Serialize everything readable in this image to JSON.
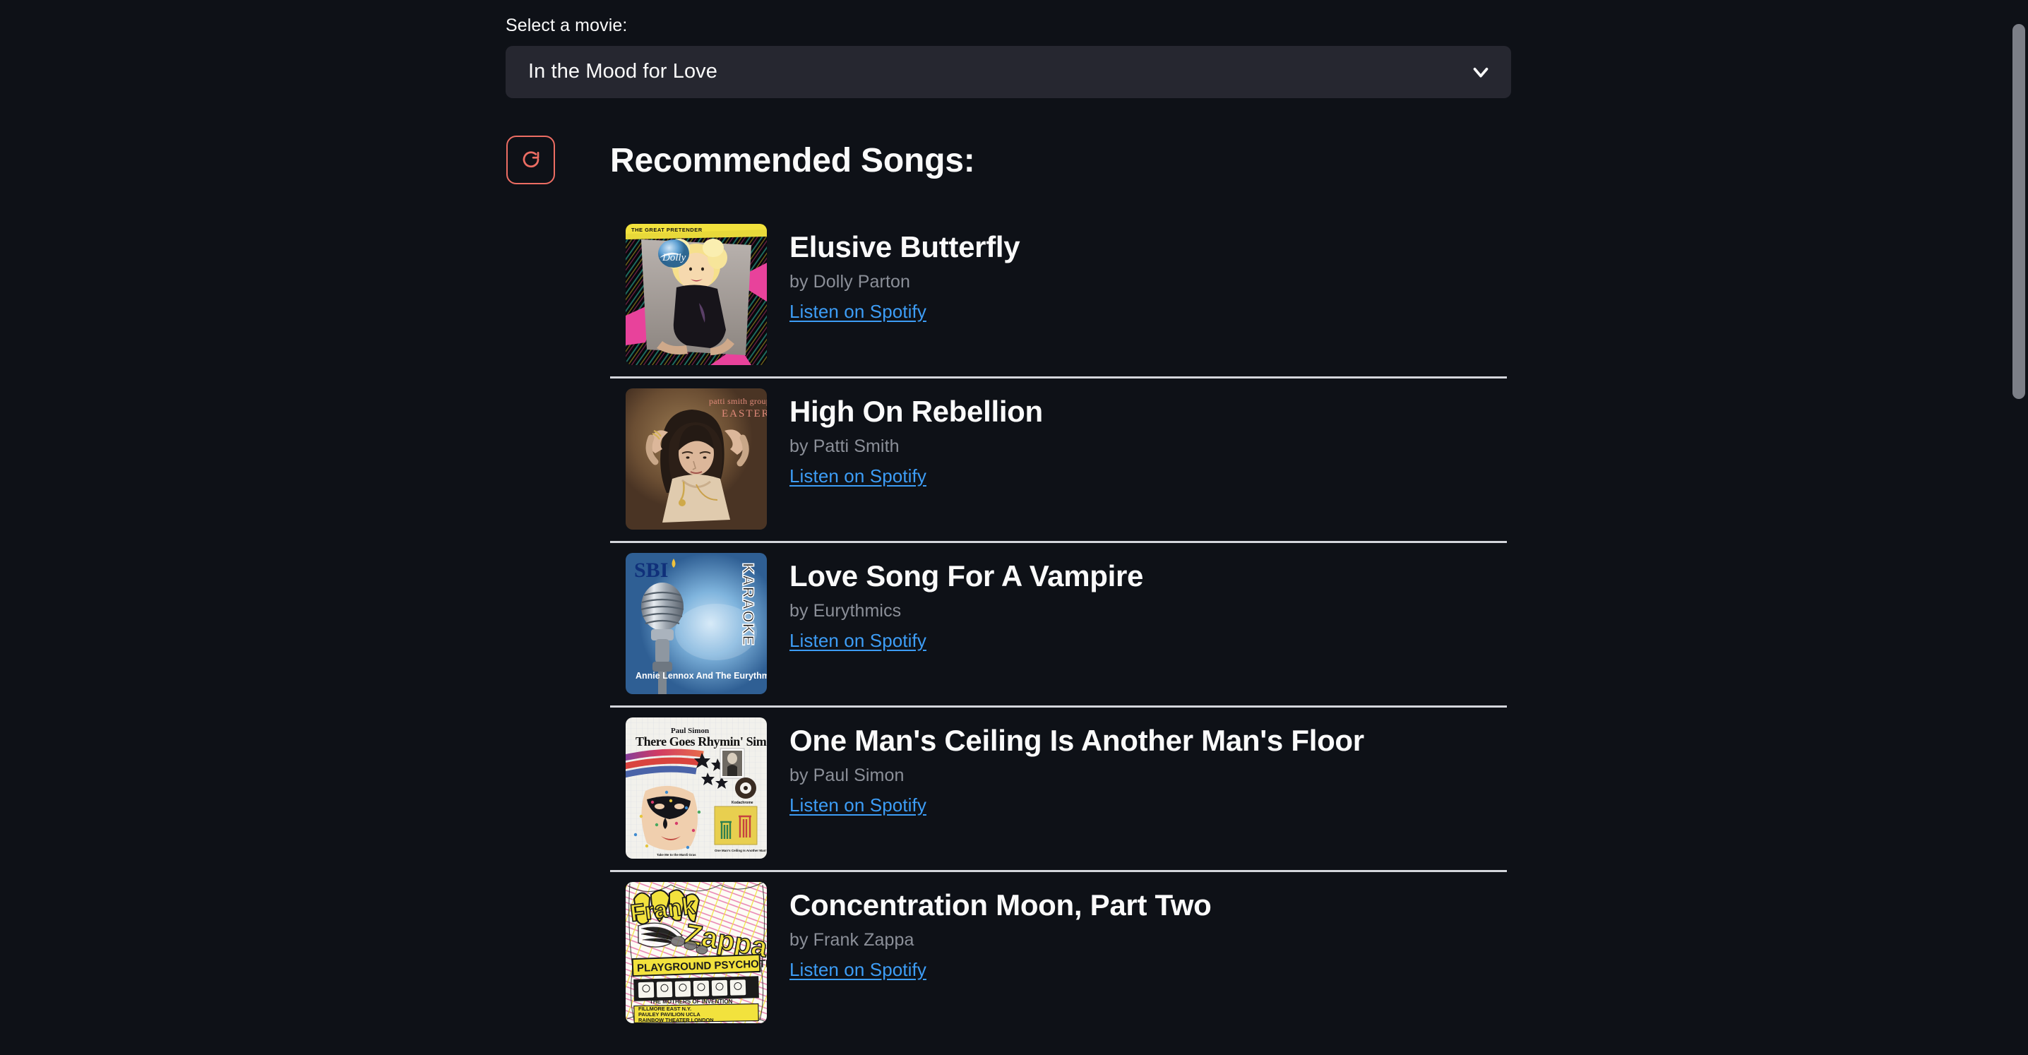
{
  "page": {
    "background_color": "#0e1117",
    "text_color": "#fafafa"
  },
  "select": {
    "label": "Select a movie:",
    "value": "In the Mood for Love",
    "chevron_icon": "chevron-down-icon",
    "background_color": "#262730"
  },
  "refresh": {
    "icon": "refresh-rotate-icon",
    "accent_color": "#ec6d63",
    "label": ""
  },
  "heading": "Recommended Songs:",
  "link_color": "#3d9df6",
  "songs": [
    {
      "title": "Elusive Butterfly",
      "artist": "by Dolly Parton",
      "link_label": "Listen on Spotify",
      "album_art": "dolly-parton-the-great-pretender-cover",
      "album_art_text": "THE GREAT PRETENDER"
    },
    {
      "title": "High On Rebellion",
      "artist": "by Patti Smith",
      "link_label": "Listen on Spotify",
      "album_art": "patti-smith-group-easter-cover",
      "album_art_text": "patti smith group EASTER"
    },
    {
      "title": "Love Song For A Vampire",
      "artist": "by Eurythmics",
      "link_label": "Listen on Spotify",
      "album_art": "sbi-karaoke-annie-lennox-eurythmics-cover",
      "album_art_text": "SBI KARAOKE Annie Lennox And The Eurythmics"
    },
    {
      "title": "One Man's Ceiling Is Another Man's Floor",
      "artist": "by Paul Simon",
      "link_label": "Listen on Spotify",
      "album_art": "paul-simon-there-goes-rhymin-simon-cover",
      "album_art_text": "Paul Simon There Goes Rhymin' Simon"
    },
    {
      "title": "Concentration Moon, Part Two",
      "artist": "by Frank Zappa",
      "link_label": "Listen on Spotify",
      "album_art": "frank-zappa-playground-psychotics-cover",
      "album_art_text": "Frank Zappa PLAYGROUND PSYCHOTICS"
    }
  ],
  "scrollbar": {
    "orientation": "vertical"
  }
}
